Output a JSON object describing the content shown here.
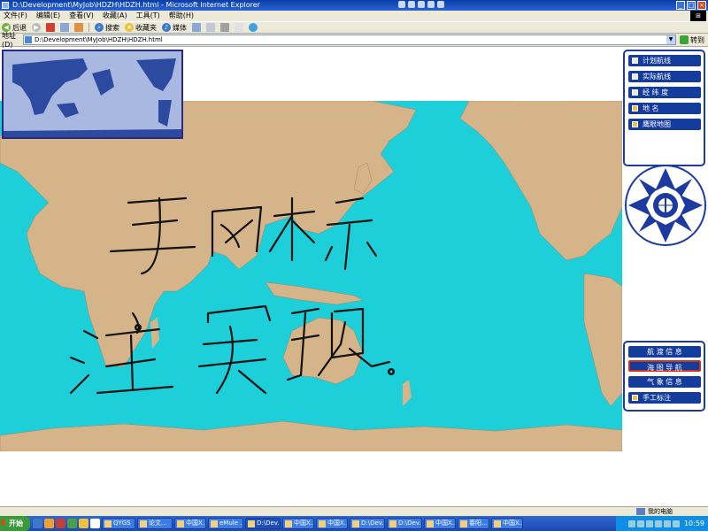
{
  "window": {
    "title": "D:\\Development\\MyJob\\HDZH\\HDZH.html - Microsoft Internet Explorer"
  },
  "menu": [
    "文件(F)",
    "编辑(E)",
    "查看(V)",
    "收藏(A)",
    "工具(T)",
    "帮助(H)"
  ],
  "toolbar": {
    "back": "后退",
    "search": "搜索",
    "favorites": "收藏夹",
    "media": "媒体"
  },
  "address": {
    "label": "地址(D)",
    "value": "D:\\Development\\MyJob\\HDZH\\HDZH.html",
    "go": "转到"
  },
  "panel": {
    "top_buttons": [
      "计划航线",
      "实际航线",
      "经 纬 度",
      "地   名",
      "鹰眼地图"
    ],
    "bottom_buttons": [
      "航 渡 信 息",
      "海 图 导 航",
      "气 象 信 息",
      "手工标注"
    ]
  },
  "colors": {
    "ocean": "#1ccfd8",
    "land": "#d2b48c",
    "panel_blue": "#143c9c",
    "border_red": "#e07060",
    "minimap_ocean": "#a8b8e0",
    "minimap_land": "#2c4aa0"
  },
  "status": {
    "computer": "我的电脑"
  },
  "taskbar": {
    "start": "开始",
    "tasks": [
      "QYGS",
      "论文...",
      "中国X...",
      "eMule ...",
      "D:\\Dev...",
      "中国X...",
      "中国X...",
      "D:\\Dev...",
      "D:\\Dev...",
      "中国X...",
      "春阳...",
      "中国X..."
    ],
    "clock": "10:59"
  }
}
